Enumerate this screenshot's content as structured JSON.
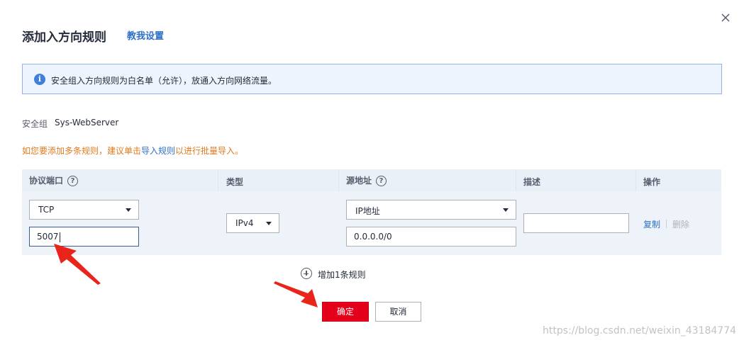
{
  "dialog": {
    "title": "添加入方向规则",
    "help_link": "教我设置",
    "close_icon": "close-icon"
  },
  "info": {
    "icon": "info-icon",
    "icon_glyph": "i",
    "text": "安全组入方向规则为白名单（允许），放通入方向网络流量。"
  },
  "security_group": {
    "label": "安全组",
    "value": "Sys-WebServer"
  },
  "hint": {
    "prefix": "如您要添加多条规则，建议单击",
    "link": "导入规则",
    "suffix": "以进行批量导入。"
  },
  "table": {
    "headers": {
      "protocol_port": "协议端口",
      "type": "类型",
      "source": "源地址",
      "description": "描述",
      "action": "操作"
    },
    "help_glyph": "?",
    "row": {
      "protocol": "TCP",
      "port": "5007",
      "type": "IPv4",
      "source_type": "IP地址",
      "source_ip": "0.0.0.0/0",
      "description": "",
      "copy": "复制",
      "delete": "删除"
    }
  },
  "add_rule": "增加1条规则",
  "buttons": {
    "ok": "确定",
    "cancel": "取消"
  },
  "colors": {
    "primary_button": "#e4001b",
    "link": "#2f6fc6",
    "warning_text": "#e07a1f",
    "annotation_arrow": "#e8241b"
  },
  "watermark": "https://blog.csdn.net/weixin_43184774"
}
